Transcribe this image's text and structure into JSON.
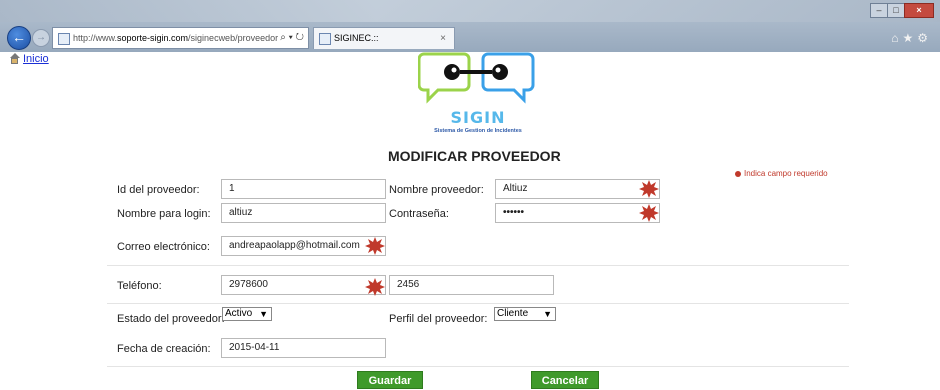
{
  "browser": {
    "url_prefix": "http://www.",
    "url_domain": "soporte-sigin.com",
    "url_path": "/siginecweb/proveedor",
    "url_tools": "⌕ ▾ ↻",
    "tab_title": "SIGINEC.::",
    "tab_close": "×",
    "back_icon": "←",
    "forward_icon": "→",
    "window_buttons": [
      "–",
      "□",
      "×"
    ],
    "toolbar_icons": "⌂★⚙"
  },
  "nav": {
    "home_label": "Inicio"
  },
  "logo": {
    "name": "SIGIN",
    "subtitle": "Sistema de Gestion de Incidentes"
  },
  "form": {
    "title": "MODIFICAR PROVEEDOR",
    "required_note": "Indica campo requerido",
    "labels": {
      "id": "Id del proveedor:",
      "nombre": "Nombre proveedor:",
      "login": "Nombre para login:",
      "password": "Contraseña:",
      "email": "Correo electrónico:",
      "telefono": "Teléfono:",
      "estado": "Estado del proveedor:",
      "perfil": "Perfil del proveedor:",
      "fecha": "Fecha de creación:"
    },
    "values": {
      "id": "1",
      "nombre": "Altiuz",
      "login": "altiuz",
      "password": "••••••",
      "email": "andreapaolapp@hotmail.com",
      "telefono": "2978600",
      "extension": "2456",
      "estado": "Activo",
      "perfil": "Cliente",
      "fecha": "2015-04-11"
    },
    "buttons": {
      "save": "Guardar",
      "cancel": "Cancelar"
    }
  },
  "colors": {
    "required_icon": "#c0392b",
    "button": "#3f9a2b",
    "link": "#1a2fd6",
    "logo_green": "#9bd34a",
    "logo_blue": "#3aa0e8"
  }
}
